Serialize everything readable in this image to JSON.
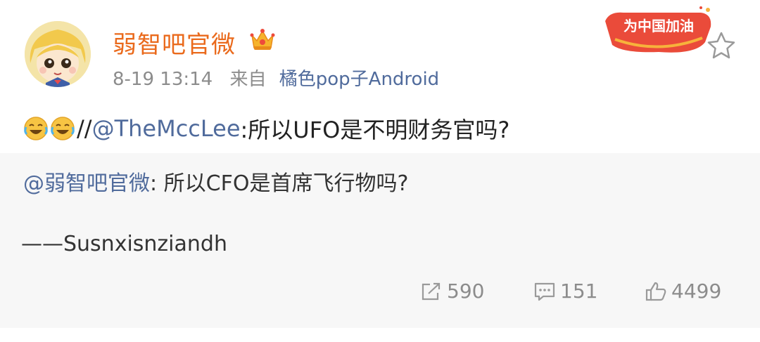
{
  "post": {
    "author": "弱智吧官微",
    "time": "8-19 13:14",
    "source_prefix": "来自",
    "source": "橘色pop子Android",
    "badge_text": "为中国加油",
    "content": {
      "emojis": [
        "laugh-cry-emoji",
        "laugh-cry-emoji"
      ],
      "prefix": "//",
      "mention": "@TheMccLee",
      "text": ":所以UFO是不明财务官吗?"
    }
  },
  "repost": {
    "mention": "@弱智吧官微",
    "text": ": 所以CFO是首席飞行物吗?",
    "signature": "——Susnxisnziandh",
    "stats": {
      "reposts": "590",
      "comments": "151",
      "likes": "4499"
    }
  },
  "colors": {
    "author": "#ea6a1c",
    "link": "#506b9c",
    "meta": "#8c8c8c",
    "repost_bg": "#f7f7f7"
  }
}
